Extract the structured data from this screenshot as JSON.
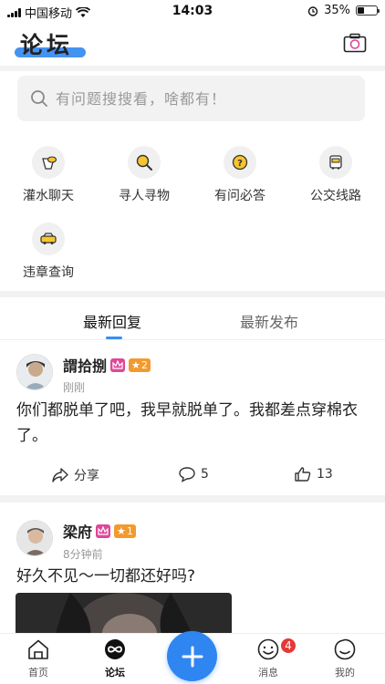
{
  "status_bar": {
    "carrier": "中国移动",
    "time": "14:03",
    "battery": "35%",
    "battery_level": 0.35
  },
  "header": {
    "title": "论坛"
  },
  "search": {
    "placeholder": "有问题搜搜看，啥都有！"
  },
  "categories": [
    {
      "label": "灌水聊天",
      "icon": "cup-icon"
    },
    {
      "label": "寻人寻物",
      "icon": "magnifier-icon"
    },
    {
      "label": "有问必答",
      "icon": "question-icon"
    },
    {
      "label": "公交线路",
      "icon": "bus-icon"
    },
    {
      "label": "违章查询",
      "icon": "car-icon"
    }
  ],
  "tabs": [
    {
      "label": "最新回复",
      "active": true
    },
    {
      "label": "最新发布",
      "active": false
    }
  ],
  "posts": [
    {
      "username": "謂拾捌",
      "level": "2",
      "time": "刚刚",
      "content": "你们都脱单了吧，我早就脱单了。我都差点穿棉衣了。",
      "share_label": "分享",
      "comments": "5",
      "likes": "13"
    },
    {
      "username": "梁府",
      "level": "1",
      "time": "8分钟前",
      "content": "好久不见～一切都还好吗?"
    }
  ],
  "bottom_nav": [
    {
      "label": "首页",
      "icon": "home-icon"
    },
    {
      "label": "论坛",
      "icon": "forum-icon"
    },
    {
      "label": "消息",
      "icon": "smile-icon",
      "badge": "4"
    },
    {
      "label": "我的",
      "icon": "profile-icon"
    }
  ],
  "colors": {
    "accent": "#3b8df0",
    "fab": "#2f86f0",
    "badge": "#e53935",
    "vip": "#e0469a",
    "level": "#f39a2e"
  }
}
